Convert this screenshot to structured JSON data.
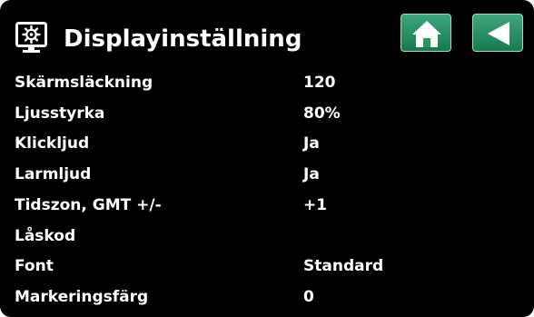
{
  "header": {
    "title": "Displayinställning",
    "title_icon": "display-monitor-icon",
    "home_icon": "home-icon",
    "back_icon": "back-arrow-icon"
  },
  "colors": {
    "background": "#000000",
    "text": "#ffffff",
    "button_green": "#228b5a"
  },
  "settings": [
    {
      "label": "Skärmsläckning",
      "value": "120"
    },
    {
      "label": "Ljusstyrka",
      "value": "80%"
    },
    {
      "label": "Klickljud",
      "value": "Ja"
    },
    {
      "label": "Larmljud",
      "value": "Ja"
    },
    {
      "label": "Tidszon, GMT +/-",
      "value": "+1"
    },
    {
      "label": "Låskod",
      "value": ""
    },
    {
      "label": "Font",
      "value": "Standard"
    },
    {
      "label": "Markeringsfärg",
      "value": "0"
    }
  ]
}
